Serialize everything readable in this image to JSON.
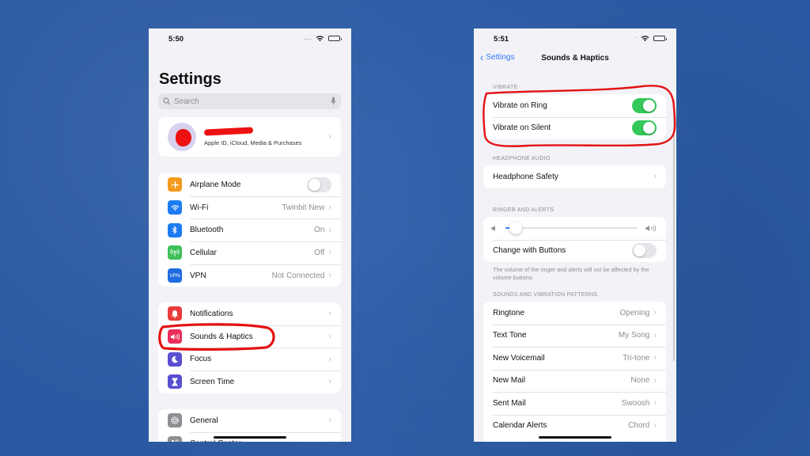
{
  "left_screen": {
    "status_bar": {
      "time": "5:50",
      "signal": "....",
      "battery_level": 0.55
    },
    "title": "Settings",
    "search": {
      "placeholder": "Search"
    },
    "profile": {
      "name_redacted": true,
      "subtitle": "Apple ID, iCloud, Media & Purchases"
    },
    "connectivity_group": [
      {
        "label": "Airplane Mode",
        "icon": "airplane-icon",
        "icon_color": "#f39a1e",
        "type": "toggle",
        "on": false
      },
      {
        "label": "Wi-Fi",
        "icon": "wifi-icon",
        "icon_color": "#1e7cf2",
        "value": "Twinbit New"
      },
      {
        "label": "Bluetooth",
        "icon": "bluetooth-icon",
        "icon_color": "#1e7cf2",
        "value": "On"
      },
      {
        "label": "Cellular",
        "icon": "cellular-icon",
        "icon_color": "#3fc05a",
        "value": "Off"
      },
      {
        "label": "VPN",
        "icon": "vpn-icon",
        "icon_color": "#1e6ce0",
        "icon_text": "VPN",
        "value": "Not Connected"
      }
    ],
    "notifications_group": [
      {
        "label": "Notifications",
        "icon": "notification-bell-icon",
        "icon_color": "#ea3b3b"
      },
      {
        "label": "Sounds & Haptics",
        "icon": "speaker-icon",
        "icon_color": "#ea2e5a",
        "highlighted": true
      },
      {
        "label": "Focus",
        "icon": "moon-icon",
        "icon_color": "#5a4fd0"
      },
      {
        "label": "Screen Time",
        "icon": "hourglass-icon",
        "icon_color": "#5a4fd0"
      }
    ],
    "general_group": [
      {
        "label": "General",
        "icon": "gear-icon",
        "icon_color": "#8e8e93"
      },
      {
        "label": "Control Center",
        "icon": "control-center-icon",
        "icon_color": "#8e8e93"
      }
    ]
  },
  "right_screen": {
    "status_bar": {
      "time": "5:51",
      "battery_level": 0.55
    },
    "nav": {
      "back_label": "Settings",
      "title": "Sounds & Haptics"
    },
    "vibrate": {
      "header": "VIBRATE",
      "rows": [
        {
          "label": "Vibrate on Ring",
          "on": true
        },
        {
          "label": "Vibrate on Silent",
          "on": true
        }
      ]
    },
    "headphone_audio": {
      "header": "HEADPHONE AUDIO",
      "rows": [
        {
          "label": "Headphone Safety"
        }
      ]
    },
    "ringer_alerts": {
      "header": "RINGER AND ALERTS",
      "volume": 0.08,
      "change_with_buttons": {
        "label": "Change with Buttons",
        "on": false
      },
      "footer": "The volume of the ringer and alerts will not be affected by the volume buttons."
    },
    "sounds_patterns": {
      "header": "SOUNDS AND VIBRATION PATTERNS",
      "rows": [
        {
          "label": "Ringtone",
          "value": "Opening"
        },
        {
          "label": "Text Tone",
          "value": "My Song"
        },
        {
          "label": "New Voicemail",
          "value": "Tri-tone"
        },
        {
          "label": "New Mail",
          "value": "None"
        },
        {
          "label": "Sent Mail",
          "value": "Swoosh"
        },
        {
          "label": "Calendar Alerts",
          "value": "Chord"
        }
      ]
    }
  },
  "colors": {
    "annotation": "#e31212",
    "toggle_on": "#34c759",
    "link_blue": "#2f7bf5",
    "background": "#2f5fa8"
  },
  "glyphs": {
    "chevron": "›",
    "back_chevron": "‹"
  }
}
